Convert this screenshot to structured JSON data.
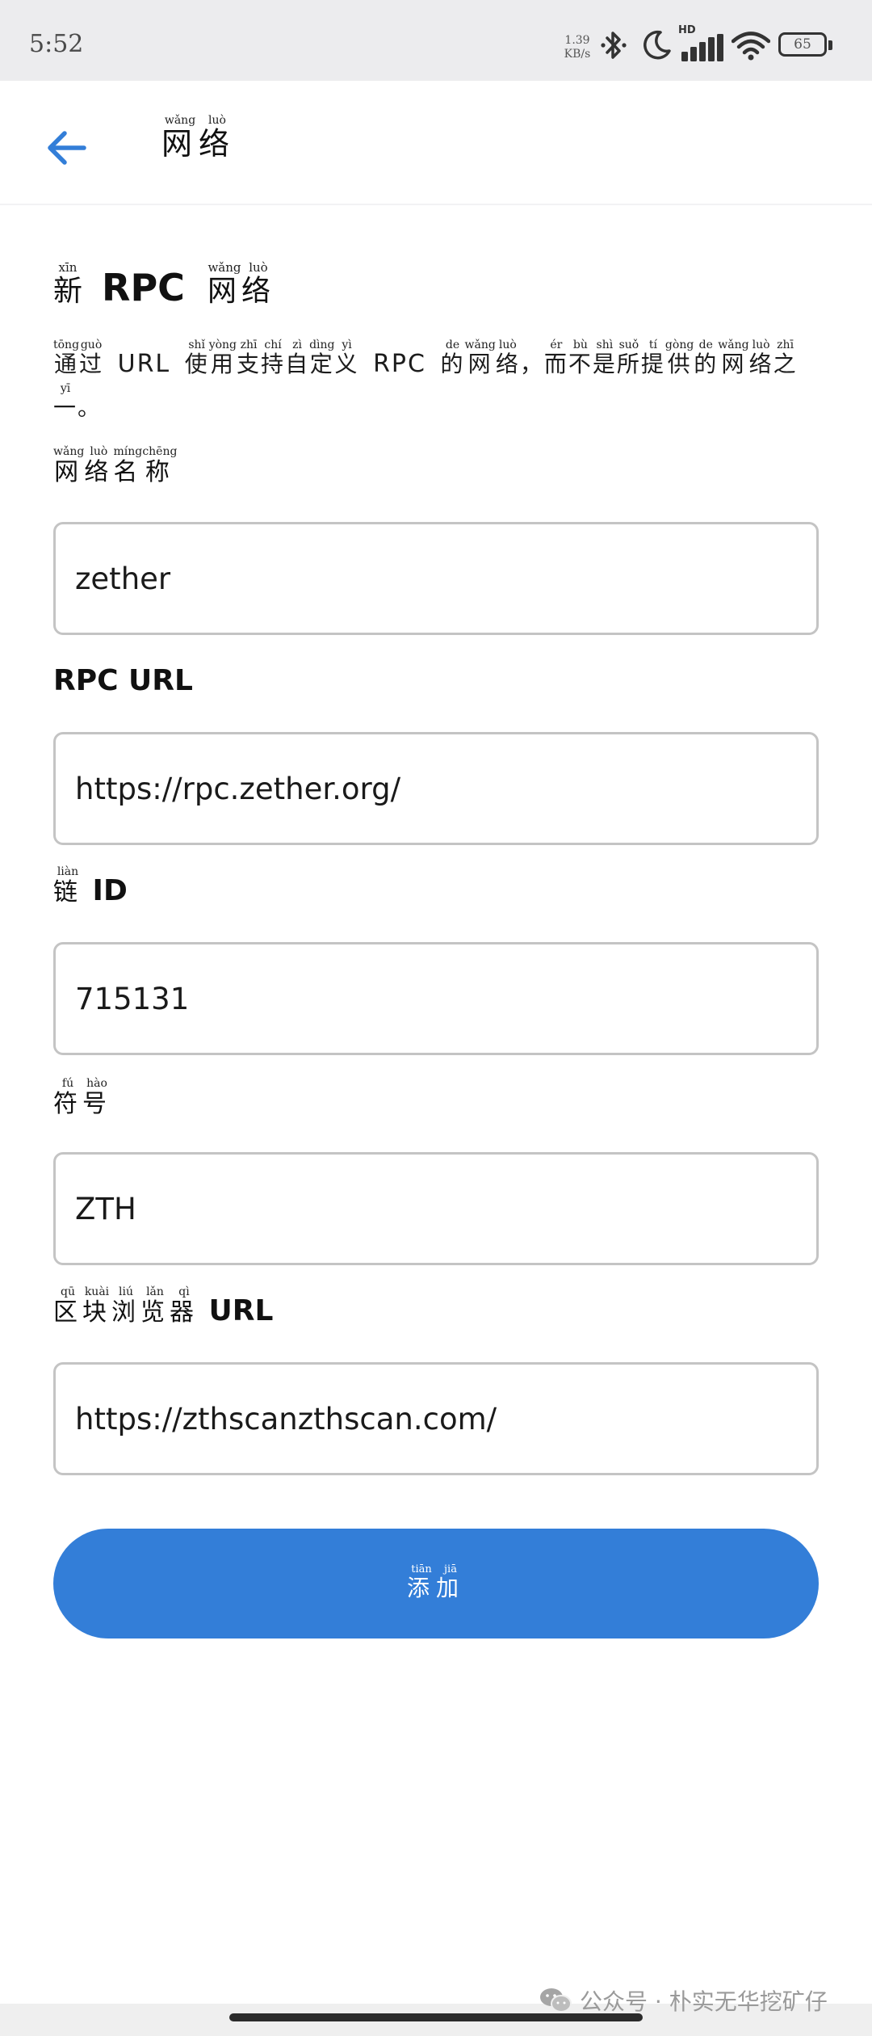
{
  "status_bar": {
    "time": "5:52",
    "net_speed_value": "1.39",
    "net_speed_unit": "KB/s",
    "signal_label": "HD",
    "battery": "65",
    "icons": [
      "bluetooth-icon",
      "moon-icon",
      "signal-icon",
      "wifi-icon",
      "battery-icon"
    ]
  },
  "header": {
    "back_icon": "arrow-left-icon",
    "title": [
      {
        "char": "网",
        "pinyin": "wǎng"
      },
      {
        "char": "络",
        "pinyin": "luò"
      }
    ]
  },
  "page": {
    "title": {
      "prefix": [
        {
          "char": "新",
          "pinyin": "xīn"
        }
      ],
      "latin": "RPC",
      "suffix": [
        {
          "char": "网",
          "pinyin": "wǎng"
        },
        {
          "char": "络",
          "pinyin": "luò"
        }
      ]
    },
    "description": {
      "part1": [
        {
          "char": "通",
          "pinyin": "tōng"
        },
        {
          "char": "过",
          "pinyin": "guò"
        }
      ],
      "latin1": "URL",
      "part2": [
        {
          "char": "使",
          "pinyin": "shǐ"
        },
        {
          "char": "用",
          "pinyin": "yòng"
        },
        {
          "char": "支",
          "pinyin": "zhī"
        },
        {
          "char": "持",
          "pinyin": "chí"
        },
        {
          "char": "自",
          "pinyin": "zì"
        },
        {
          "char": "定",
          "pinyin": "dìng"
        },
        {
          "char": "义",
          "pinyin": "yì"
        }
      ],
      "latin2": "RPC",
      "part3": [
        {
          "char": "的",
          "pinyin": "de"
        },
        {
          "char": "网",
          "pinyin": "wǎng"
        },
        {
          "char": "络",
          "pinyin": "luò"
        },
        {
          "char": "，",
          "pinyin": ""
        },
        {
          "char": "而",
          "pinyin": "ér"
        },
        {
          "char": "不",
          "pinyin": "bù"
        },
        {
          "char": "是",
          "pinyin": "shì"
        },
        {
          "char": "所",
          "pinyin": "suǒ"
        },
        {
          "char": "提",
          "pinyin": "tí"
        },
        {
          "char": "供",
          "pinyin": "gòng"
        },
        {
          "char": "的",
          "pinyin": "de"
        },
        {
          "char": "网",
          "pinyin": "wǎng"
        },
        {
          "char": "络",
          "pinyin": "luò"
        },
        {
          "char": "之",
          "pinyin": "zhī"
        },
        {
          "char": "一",
          "pinyin": "yī"
        },
        {
          "char": "。",
          "pinyin": ""
        }
      ]
    }
  },
  "fields": [
    {
      "label_zh": [
        {
          "char": "网",
          "pinyin": "wǎng"
        },
        {
          "char": "络",
          "pinyin": "luò"
        },
        {
          "char": "名",
          "pinyin": "míng"
        },
        {
          "char": "称",
          "pinyin": "chēng"
        }
      ],
      "label_latin": "",
      "value": "zether"
    },
    {
      "label_zh": [],
      "label_latin": "RPC URL",
      "value": "https://rpc.zether.org/"
    },
    {
      "label_zh": [
        {
          "char": "链",
          "pinyin": "liàn"
        }
      ],
      "label_latin": "ID",
      "value": "715131"
    },
    {
      "label_zh": [
        {
          "char": "符",
          "pinyin": "fú"
        },
        {
          "char": "号",
          "pinyin": "hào"
        }
      ],
      "label_latin": "",
      "value": "ZTH"
    },
    {
      "label_zh": [
        {
          "char": "区",
          "pinyin": "qū"
        },
        {
          "char": "块",
          "pinyin": "kuài"
        },
        {
          "char": "浏",
          "pinyin": "liú"
        },
        {
          "char": "览",
          "pinyin": "lǎn"
        },
        {
          "char": "器",
          "pinyin": "qì"
        }
      ],
      "label_latin": "URL",
      "value": "https://zthscanzthscan.com/"
    }
  ],
  "add_button": {
    "label": [
      {
        "char": "添",
        "pinyin": "tiān"
      },
      {
        "char": "加",
        "pinyin": "jiā"
      }
    ]
  },
  "watermark": {
    "icon": "wechat-icon",
    "text": "公众号 · 朴实无华挖矿仔"
  },
  "colors": {
    "accent": "#337ed8",
    "status_bar_bg": "#ececee",
    "input_border": "#c4c4c4",
    "text": "#111111"
  }
}
